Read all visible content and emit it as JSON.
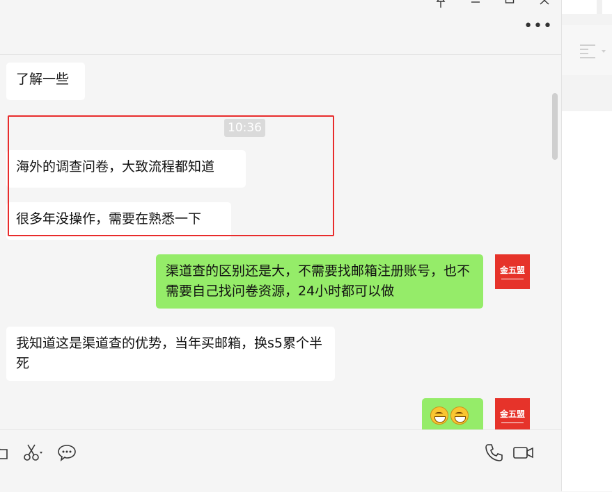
{
  "window": {
    "pin_glyph": "⚲",
    "minimize_glyph": "—",
    "maximize_glyph": "☐",
    "close_glyph": "✕",
    "more_glyph": "•••"
  },
  "messages": [
    {
      "side": "left",
      "text": "了解一些"
    },
    {
      "side": "left",
      "text": "海外的调查问卷，大致流程都知道"
    },
    {
      "side": "left",
      "text": "很多年没操作，需要在熟悉一下"
    },
    {
      "side": "right",
      "text": "渠道查的区别还是大，不需要找邮箱注册账号，也不需要自己找问卷资源，24小时都可以做"
    },
    {
      "side": "left",
      "text": "我知道这是渠道查的优势，当年买邮箱，换s5累个半死"
    },
    {
      "side": "right",
      "emoji": [
        "grinning-face",
        "grinning-face"
      ]
    }
  ],
  "timestamp": "10:36",
  "avatar": {
    "text": "金五盟",
    "color": "#e6332a"
  },
  "colors": {
    "incoming_bubble": "#ffffff",
    "outgoing_bubble": "#95ec69",
    "highlight_border": "#e82b2b",
    "background": "#f5f5f5"
  },
  "toolbar_icons": [
    "folder-icon",
    "scissors-icon",
    "chat-bubble-icon",
    "phone-icon",
    "video-call-icon"
  ]
}
